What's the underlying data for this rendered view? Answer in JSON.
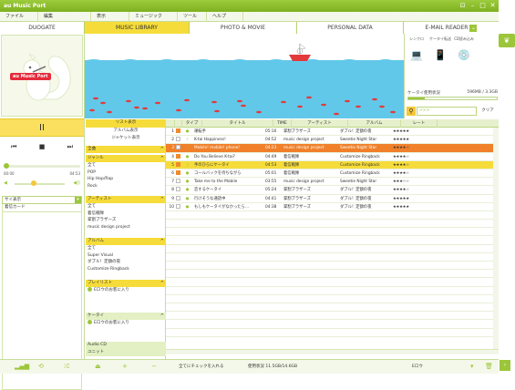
{
  "window": {
    "title": "au Music Port"
  },
  "menu": [
    "ファイル",
    "編集",
    "表示",
    "ミュージック",
    "ツール",
    "ヘルプ"
  ],
  "tabs": [
    "DUOGATE",
    "MUSIC LIBRARY",
    "PHOTO & MOVIE",
    "PERSONAL DATA",
    "E-MAIL READER"
  ],
  "player": {
    "logo": "au Music Port",
    "play_icon": "II",
    "time_elapsed": "00:00",
    "time_total": "04:53",
    "select_label": "サイ表示",
    "list_label": "着信カード"
  },
  "device": {
    "headers": [
      "シンクロ",
      "ケータイ転送",
      "CD読み込み",
      ""
    ],
    "status_label": "ケータイ使用状況",
    "status_value": "596MB / 3.3GB",
    "search_placeholder": ">>>",
    "clear_label": "クリア"
  },
  "nav": {
    "top": [
      "リスト表示",
      "アルバム表示",
      "ジャケット表示"
    ],
    "all_label": "全曲",
    "genre": {
      "title": "ジャンル",
      "items": [
        "全て",
        "POP",
        "Hip Hop/Rap",
        "Rock"
      ]
    },
    "artist": {
      "title": "アーティスト",
      "items": [
        "全て",
        "着信戦隊",
        "掌割プラザーズ",
        "music design project"
      ]
    },
    "album": {
      "title": "アルバム",
      "items": [
        "全て",
        "Super Visual",
        "ダブル！定額の夜",
        "Customize Ringback"
      ]
    },
    "playlist": {
      "title": "プレイリスト",
      "items": [
        "Eロウのお客に入り"
      ]
    },
    "keitai": {
      "title": "ケータイ",
      "items": [
        "Eロウのお客に入り"
      ]
    },
    "audio_cd": "Audio CD",
    "unit": "ユニット"
  },
  "table": {
    "headers": [
      "",
      "",
      "タイプ",
      "タイトル",
      "TIME",
      "アーティスト",
      "アルバム",
      "レート"
    ],
    "rows": [
      {
        "no": "1",
        "title": "運転手",
        "time": "05:16",
        "artist": "掌割ブラザーズ",
        "album": "ダブル！定額の夜",
        "rate": "★★★★★",
        "style": ""
      },
      {
        "no": "2",
        "title": "K-tai Happiness!",
        "time": "04:52",
        "artist": "music design project",
        "album": "Sweetie Night Star",
        "rate": "★★★★★",
        "style": ""
      },
      {
        "no": "3",
        "title": "Mobile! mobile! phone!",
        "time": "04:23",
        "artist": "music design project",
        "album": "Sweetie Night Star",
        "rate": "★★★★☆",
        "style": "orange"
      },
      {
        "no": "4",
        "title": "Do You Believe K-tai?",
        "time": "04:49",
        "artist": "着信戦隊",
        "album": "Customize Ringback",
        "rate": "★★★★☆",
        "style": ""
      },
      {
        "no": "5",
        "title": "手のひらにケータイ",
        "time": "04:53",
        "artist": "着信戦隊",
        "album": "Customize Ringback",
        "rate": "★★★★☆",
        "style": "yellow"
      },
      {
        "no": "6",
        "title": "コールバックを待ちながら",
        "time": "05:01",
        "artist": "着信戦隊",
        "album": "Customize Ringback",
        "rate": "★★★★☆",
        "style": ""
      },
      {
        "no": "7",
        "title": "Take me to the Mobile",
        "time": "03:55",
        "artist": "music design project",
        "album": "Sweetie Night Star",
        "rate": "★★★☆☆",
        "style": ""
      },
      {
        "no": "8",
        "title": "恋するケータイ",
        "time": "05:24",
        "artist": "掌割ブラザーズ",
        "album": "ダブル！定額の夜",
        "rate": "★★★★☆",
        "style": ""
      },
      {
        "no": "9",
        "title": "行けそうな通話中",
        "time": "04:41",
        "artist": "掌割ブラザーズ",
        "album": "ダブル！定額の夜",
        "rate": "★★★★★",
        "style": ""
      },
      {
        "no": "10",
        "title": "もしもケータイがなかったら…",
        "time": "04:38",
        "artist": "掌割ブラザーズ",
        "album": "ダブル！定額の夜",
        "rate": "★★★★★",
        "style": ""
      }
    ]
  },
  "bottom": {
    "check_all": "全てにチェックを入れる",
    "usage": "使用状況 11.5GB/14.6GB",
    "device": "Eロウ"
  },
  "colors": {
    "green": "#9cc63a",
    "yellow": "#f6dc3a",
    "orange": "#f0802a",
    "water": "#62c8ea"
  }
}
